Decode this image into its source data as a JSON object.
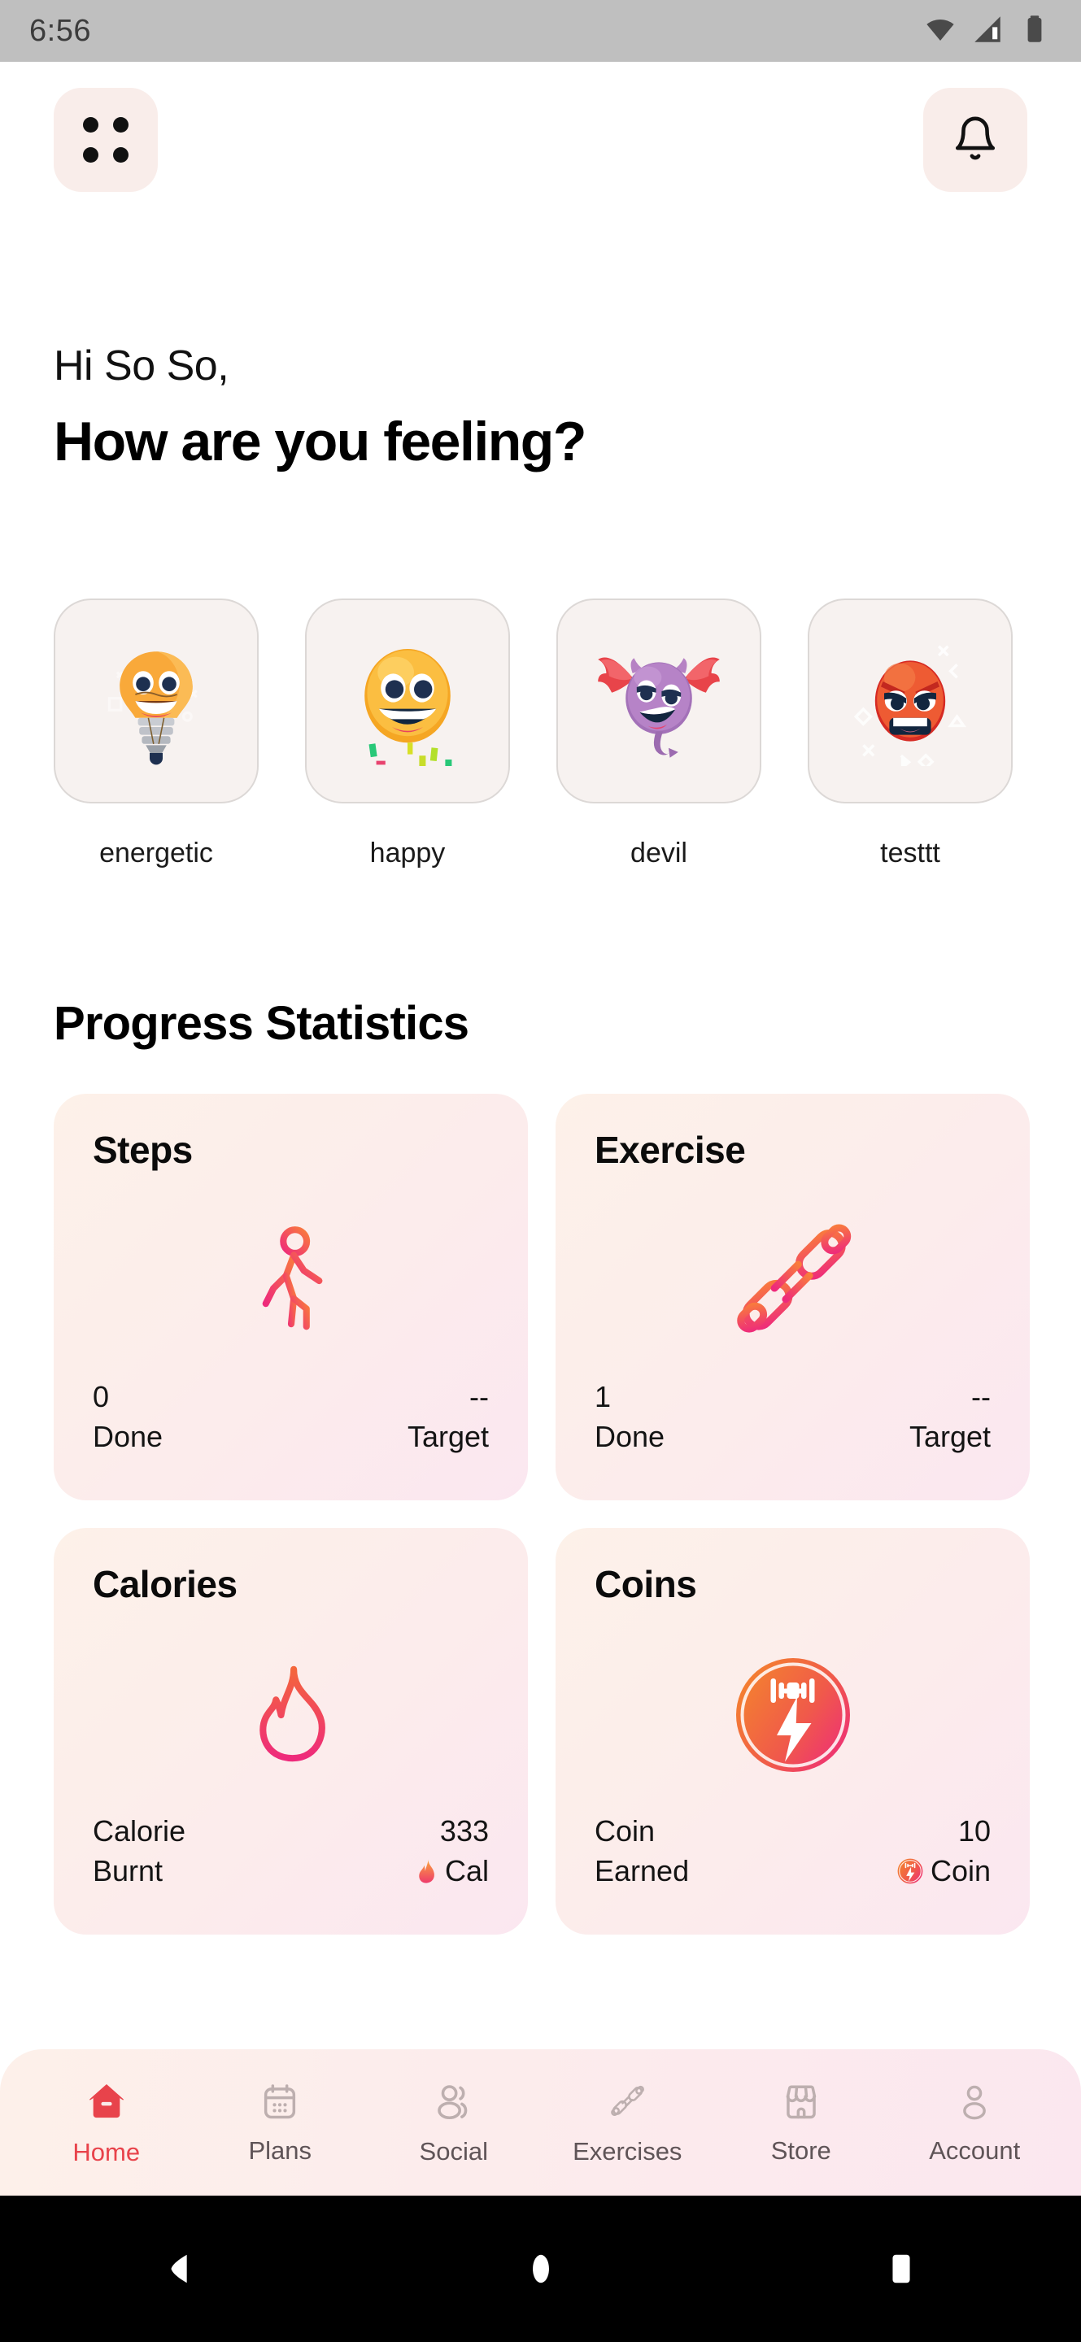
{
  "status_bar": {
    "time": "6:56",
    "icons": [
      "wifi-icon",
      "cellular-signal-icon",
      "battery-icon"
    ]
  },
  "app_bar": {
    "menu_button": "grid-menu-icon",
    "notification_button": "bell-icon"
  },
  "greeting": {
    "salutation": "Hi So So,",
    "question": "How are you feeling?"
  },
  "moods": [
    {
      "label": "energetic",
      "icon": "lightbulb-face-emoji"
    },
    {
      "label": "happy",
      "icon": "grinning-face-emoji"
    },
    {
      "label": "devil",
      "icon": "winged-devil-emoji"
    },
    {
      "label": "testtt",
      "icon": "angry-face-emoji"
    }
  ],
  "progress": {
    "section_title": "Progress Statistics",
    "cards": [
      {
        "title": "Steps",
        "icon": "walking-person-icon",
        "left_value": "0",
        "left_label": "Done",
        "right_value": "--",
        "right_label": "Target",
        "right_label_icon": ""
      },
      {
        "title": "Exercise",
        "icon": "dumbbell-icon",
        "left_value": "1",
        "left_label": "Done",
        "right_value": "--",
        "right_label": "Target",
        "right_label_icon": ""
      },
      {
        "title": "Calories",
        "icon": "flame-icon",
        "left_value": "Calorie",
        "left_label": "Burnt",
        "right_value": "333",
        "right_label": "Cal",
        "right_label_icon": "flame-badge-icon"
      },
      {
        "title": "Coins",
        "icon": "coin-lightning-icon",
        "left_value": "Coin",
        "left_label": "Earned",
        "right_value": "10",
        "right_label": "Coin",
        "right_label_icon": "coin-badge-icon"
      }
    ]
  },
  "bottom_nav": {
    "active": "Home",
    "items": [
      {
        "label": "Home",
        "icon": "house-icon"
      },
      {
        "label": "Plans",
        "icon": "calendar-icon"
      },
      {
        "label": "Social",
        "icon": "people-icon"
      },
      {
        "label": "Exercises",
        "icon": "dumbbell-icon"
      },
      {
        "label": "Store",
        "icon": "storefront-icon"
      },
      {
        "label": "Account",
        "icon": "person-icon"
      }
    ]
  },
  "android_nav": {
    "keys": [
      "back-icon",
      "home-icon",
      "recents-icon"
    ]
  },
  "colors": {
    "accent": "#E8434B",
    "gradient_start": "#F97C3C",
    "gradient_end": "#EE2A7B",
    "card_bg_start": "#FDF1E9",
    "card_bg_end": "#FBE7F0",
    "status_bar_bg": "#BFBFBF",
    "mood_card_bg": "#F7F2F0",
    "nav_inactive": "#5F5457"
  }
}
